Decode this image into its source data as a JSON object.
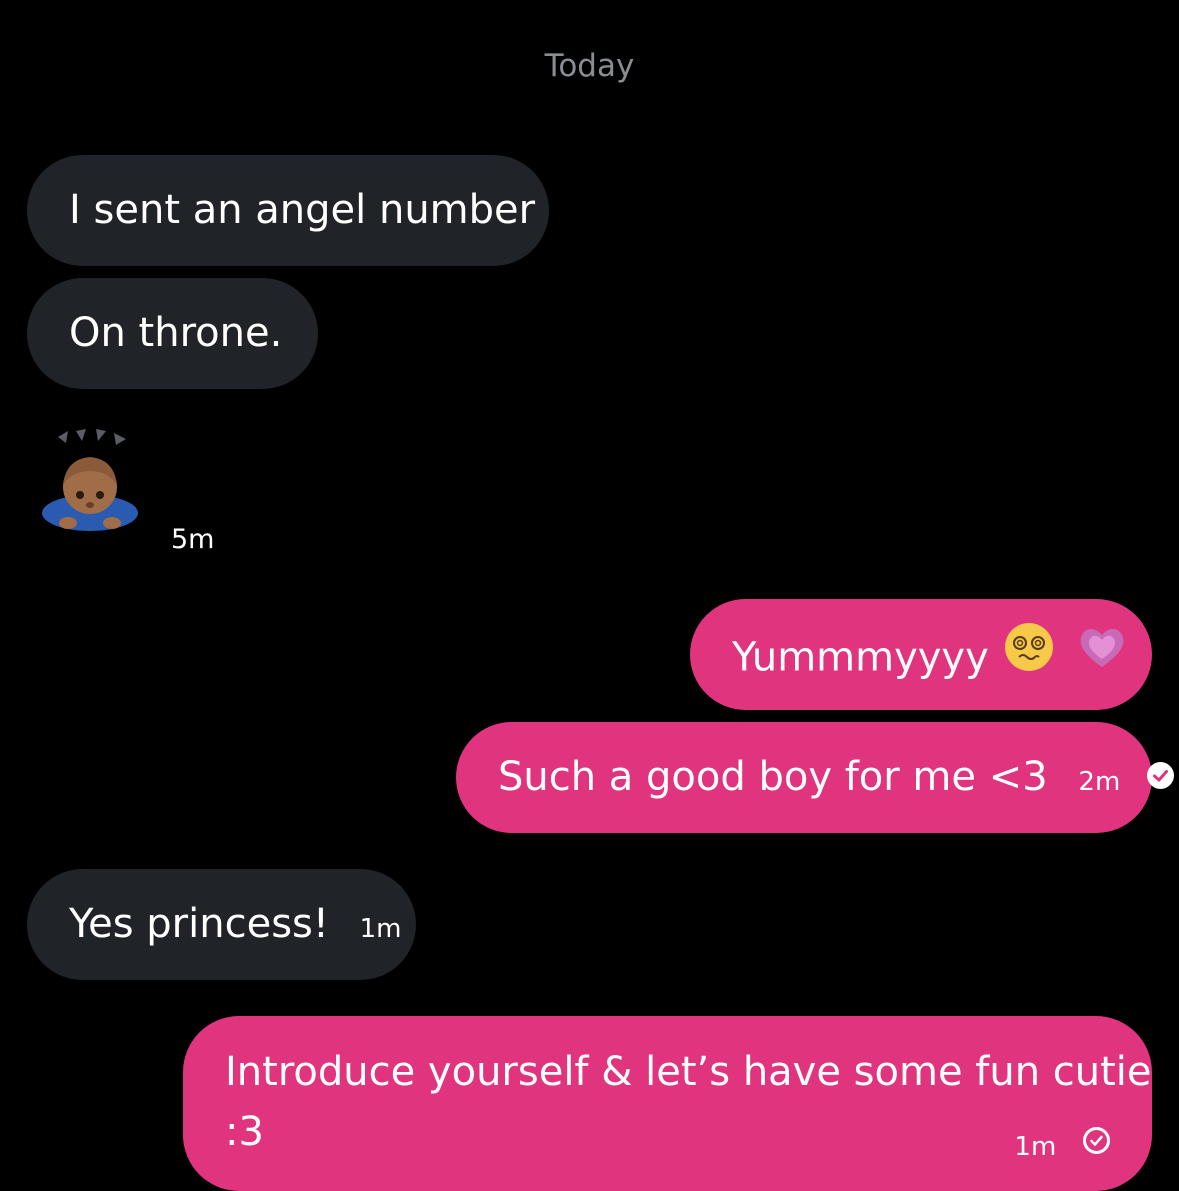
{
  "divider": {
    "date": "Today"
  },
  "messages": [
    {
      "text": "I sent an angel number"
    },
    {
      "text": "On throne."
    },
    {
      "emoji": "person-bowing-emoji",
      "time": "5m"
    },
    {
      "text": "Yummmyyyy"
    },
    {
      "text": "Such a good boy for me <3",
      "time": "2m",
      "status": "read"
    },
    {
      "text": "Yes princess!",
      "time": "1m"
    },
    {
      "text_line1": "Introduce yourself & let’s have some fun cutie",
      "text_line2": ":3",
      "time": "1m",
      "status": "sent"
    }
  ],
  "colors": {
    "incoming": "#202327",
    "outgoing": "#e0357e",
    "background": "#000000",
    "muted": "#8a8d91"
  }
}
